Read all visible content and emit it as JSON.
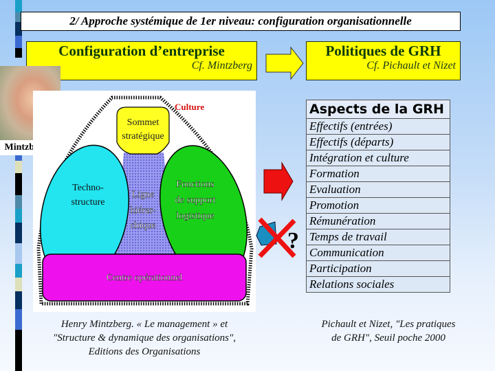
{
  "title": "2/ Approche systémique de 1er niveau: configuration organisationnelle",
  "left_box": {
    "heading": "Configuration d’entreprise",
    "subtitle": "Cf. Mintzberg"
  },
  "right_box": {
    "heading": "Politiques de GRH",
    "subtitle": "Cf. Pichault et Nizet"
  },
  "photo": {
    "label": "Mintzberg"
  },
  "diagram": {
    "culture": "Culture",
    "sommet": [
      "Sommet",
      "stratégique"
    ],
    "techno": [
      "Techno-",
      "structure"
    ],
    "ligne": [
      "Ligne",
      "hiérar-",
      "chique"
    ],
    "support": [
      "Fonctions",
      "de support",
      "logistique"
    ],
    "centre": "Centre opérationnel"
  },
  "table": {
    "header": "Aspects de la GRH",
    "rows": [
      "Effectifs (entrées)",
      "Effectifs (départs)",
      "Intégration et culture",
      "Formation",
      "Evaluation",
      "Promotion",
      "Rémunération",
      "Temps de travail",
      "Communication",
      "Participation",
      "Relations sociales"
    ]
  },
  "question_mark": "?",
  "captions": {
    "left": [
      "Henry Mintzberg. « Le management »  et",
      "\"Structure & dynamique des organisations\",",
      "Editions des Organisations"
    ],
    "right": [
      "Pichault et Nizet, \"Les pratiques",
      "de GRH\", Seuil poche 2000"
    ]
  },
  "colors": {
    "yellow": "#ffff00",
    "red_arrow": "#ee1111",
    "cyan": "#22e5f0",
    "green": "#18d018",
    "magenta": "#ee11ee",
    "sommet": "#ffff22",
    "ligne": "#8e8ee8"
  }
}
